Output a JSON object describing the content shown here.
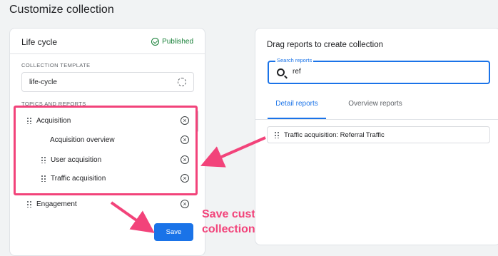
{
  "page": {
    "title": "Customize collection"
  },
  "left_panel": {
    "title": "Life cycle",
    "status": "Published",
    "template_label": "COLLECTION TEMPLATE",
    "template_value": "life-cycle",
    "topics_label": "TOPICS AND REPORTS",
    "topics": [
      {
        "label": "Acquisition"
      },
      {
        "label": "Acquisition overview"
      },
      {
        "label": "User acquisition"
      },
      {
        "label": "Traffic acquisition"
      },
      {
        "label": "Engagement"
      }
    ],
    "save_label": "Save"
  },
  "right_panel": {
    "title": "Drag reports to create collection",
    "search": {
      "label": "Search reports",
      "value": "ref"
    },
    "tabs": [
      {
        "label": "Detail reports",
        "active": true
      },
      {
        "label": "Overview reports",
        "active": false
      }
    ],
    "results": [
      {
        "label": "Traffic acquisition: Referral Traffic"
      }
    ]
  },
  "annotation": {
    "line1": "Save customized",
    "line2": "collection",
    "color": "#f2437a"
  },
  "colors": {
    "accent": "#1a73e8",
    "published": "#188038",
    "highlight": "#f2437a"
  }
}
